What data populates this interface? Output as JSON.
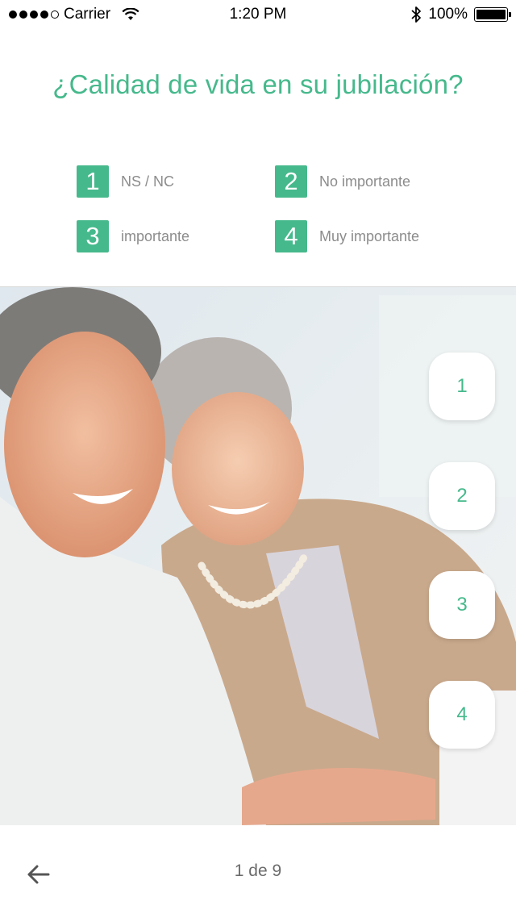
{
  "status_bar": {
    "carrier": "Carrier",
    "time": "1:20 PM",
    "battery": "100%",
    "battery_level": 1.0,
    "signal_bars_filled": 4,
    "signal_bars_total": 5
  },
  "question": "¿Calidad de vida en su jubilación?",
  "legend": [
    {
      "num": "1",
      "label": "NS / NC"
    },
    {
      "num": "2",
      "label": "No importante"
    },
    {
      "num": "3",
      "label": "importante"
    },
    {
      "num": "4",
      "label": "Muy importante"
    }
  ],
  "options": [
    "1",
    "2",
    "3",
    "4"
  ],
  "footer": {
    "pager": "1 de 9",
    "back_icon": "arrow-left-icon"
  },
  "colors": {
    "accent": "#46b98c",
    "muted_text": "#8c8c8c"
  }
}
